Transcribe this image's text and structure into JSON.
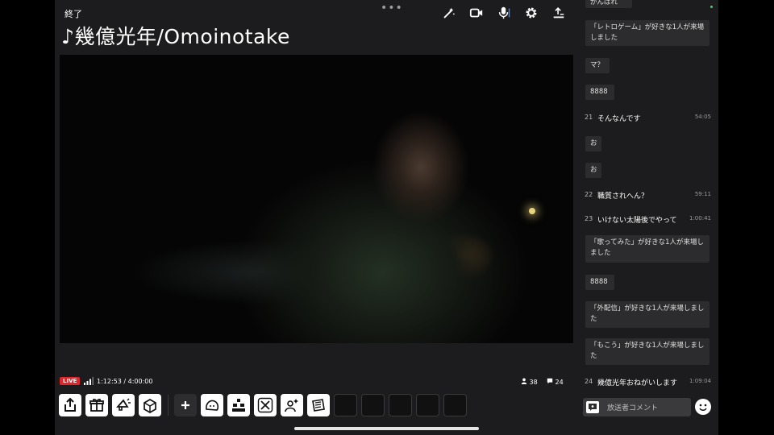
{
  "header": {
    "end_label": "終了",
    "title": "♪幾億光年/Omoinotake",
    "more_dots": "•••"
  },
  "top_icons": [
    "magic-wand-icon",
    "camera-icon",
    "microphone-icon",
    "gear-icon",
    "share-up-icon"
  ],
  "status": {
    "live": "LIVE",
    "elapsed": "1:12:53 / 4:00:00",
    "viewers": "38",
    "comments": "24"
  },
  "toolbar": {
    "buttons": [
      "share-icon",
      "gift-icon",
      "megaphone-icon",
      "box-icon",
      "plus-icon",
      "character-icon",
      "blocks-icon",
      "x-logo-icon",
      "sparkle-person-icon",
      "newspaper-icon"
    ],
    "empty_slots": 5
  },
  "comments": [
    {
      "type": "bubble",
      "text": "がんばれ"
    },
    {
      "type": "bubble",
      "text": "「レトロゲーム」が好きな1人が来場しました"
    },
    {
      "type": "bubble",
      "text": "マ？"
    },
    {
      "type": "bubble",
      "text": "8888"
    },
    {
      "type": "row",
      "num": "21",
      "text": "そんなんです",
      "time": "54:05"
    },
    {
      "type": "bubble",
      "text": "お"
    },
    {
      "type": "bubble",
      "text": "お"
    },
    {
      "type": "row",
      "num": "22",
      "text": "職質されへん？",
      "time": "59:11"
    },
    {
      "type": "row",
      "num": "23",
      "text": "いけない太陽後でやって",
      "time": "1:00:41"
    },
    {
      "type": "bubble",
      "text": "「歌ってみた」が好きな1人が来場しました"
    },
    {
      "type": "bubble",
      "text": "8888"
    },
    {
      "type": "bubble",
      "text": "「外配信」が好きな1人が来場しました"
    },
    {
      "type": "bubble",
      "text": "「もこう」が好きな1人が来場しました"
    },
    {
      "type": "row",
      "num": "24",
      "text": "幾億光年おねがいします",
      "time": "1:09:04"
    }
  ],
  "composer": {
    "placeholder": "放送者コメント"
  },
  "colors": {
    "live_red": "#e0262b",
    "panel_bg": "#1c1c1e",
    "bubble_bg": "#2c2c2e",
    "status_green": "#3ddc5a"
  }
}
